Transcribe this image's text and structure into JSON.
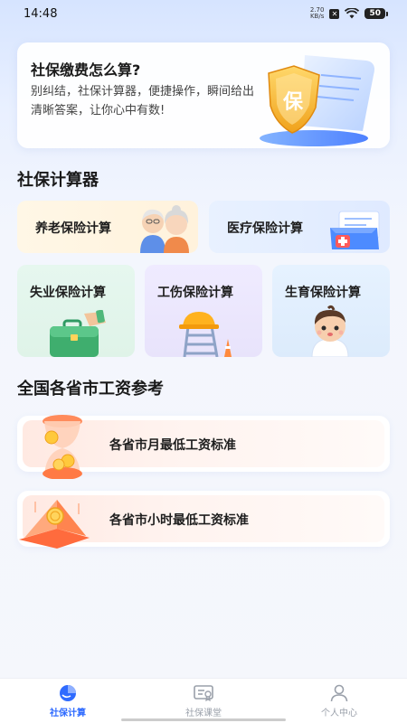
{
  "status_bar": {
    "time": "14:48",
    "net_speed_value": "2.70",
    "net_speed_unit": "KB/s",
    "battery": "50"
  },
  "hero": {
    "title": "社保缴费怎么算?",
    "description": "别纠结，社保计算器，便捷操作，瞬间给出清晰答案，让你心中有数!",
    "shield_char": "保"
  },
  "calculator_section": {
    "title": "社保计算器",
    "cards": [
      {
        "label": "养老保险计算"
      },
      {
        "label": "医疗保险计算"
      },
      {
        "label": "失业保险计算"
      },
      {
        "label": "工伤保险计算"
      },
      {
        "label": "生育保险计算"
      }
    ]
  },
  "wage_section": {
    "title": "全国各省市工资参考",
    "items": [
      {
        "label": "各省市月最低工资标准"
      },
      {
        "label": "各省市小时最低工资标准"
      }
    ]
  },
  "tab_bar": {
    "tabs": [
      {
        "label": "社保计算",
        "icon": "pie-chart-icon",
        "active": true
      },
      {
        "label": "社保课堂",
        "icon": "certificate-icon",
        "active": false
      },
      {
        "label": "个人中心",
        "icon": "person-icon",
        "active": false
      }
    ],
    "active_color": "#2f6bff",
    "inactive_color": "#9aa0aa"
  }
}
